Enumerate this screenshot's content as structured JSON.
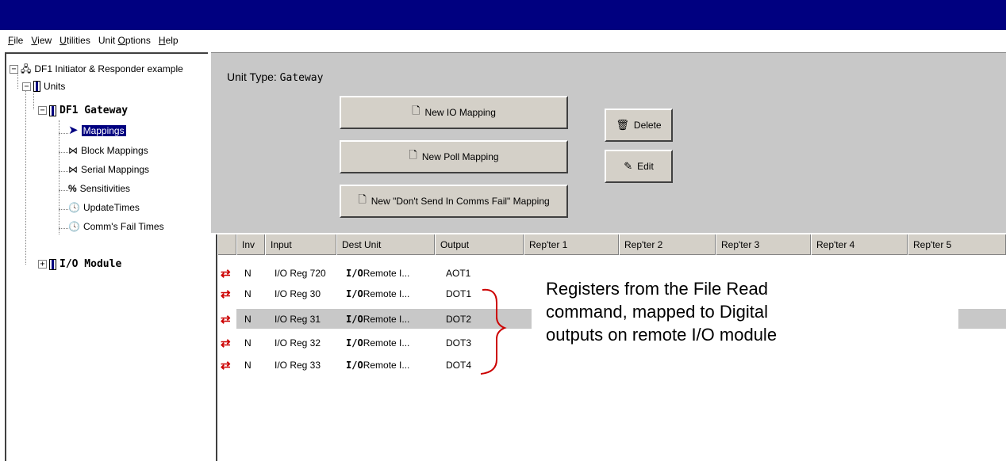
{
  "menu": [
    {
      "label": "File",
      "ul": "F",
      "rest": "ile"
    },
    {
      "label": "View",
      "ul": "V",
      "rest": "iew"
    },
    {
      "label": "Utilities",
      "ul": "U",
      "rest": "tilities"
    },
    {
      "label": "Unit Options",
      "pre": "Unit ",
      "ul": "O",
      "rest": "ptions"
    },
    {
      "label": "Help",
      "ul": "H",
      "rest": "elp"
    }
  ],
  "tree": {
    "root": "DF1 Initiator & Responder example",
    "units": "Units",
    "gateway": "DF1 Gateway",
    "children": [
      "Mappings",
      "Block Mappings",
      "Serial Mappings",
      "Sensitivities",
      "UpdateTimes",
      "Comm's Fail Times"
    ],
    "io_module": "I/O Module"
  },
  "panel": {
    "unit_type_label": "Unit Type:",
    "unit_type_value": "Gateway",
    "buttons": {
      "new_io": "New IO Mapping",
      "new_poll": "New Poll Mapping",
      "new_dont_send": "New \"Don't Send In Comms Fail\" Mapping",
      "delete": "Delete",
      "edit": "Edit"
    }
  },
  "grid": {
    "columns": [
      "Inv",
      "Input",
      "Dest Unit",
      "Output",
      "Rep'ter 1",
      "Rep'ter 2",
      "Rep'ter 3",
      "Rep'ter 4",
      "Rep'ter 5"
    ],
    "rows": [
      {
        "inv": "N",
        "input": "I/O Reg 720",
        "dest_a": "I/O",
        "dest_b": " Remote I...",
        "output": "AOT1"
      },
      {
        "inv": "N",
        "input": "I/O Reg 30",
        "dest_a": "I/O",
        "dest_b": " Remote I...",
        "output": "DOT1"
      },
      {
        "inv": "N",
        "input": "I/O Reg 31",
        "dest_a": "I/O",
        "dest_b": " Remote I...",
        "output": "DOT2"
      },
      {
        "inv": "N",
        "input": "I/O Reg 32",
        "dest_a": "I/O",
        "dest_b": " Remote I...",
        "output": "DOT3"
      },
      {
        "inv": "N",
        "input": "I/O Reg 33",
        "dest_a": "I/O",
        "dest_b": " Remote I...",
        "output": "DOT4"
      }
    ],
    "selected_row": 2
  },
  "annotation": {
    "lines": [
      "Registers from the File Read",
      "command, mapped to Digital",
      "outputs on remote I/O module"
    ]
  },
  "colors": {
    "titlebar": "#000080",
    "arrow": "#cc0000",
    "panel": "#c8c8c8"
  },
  "icons": {
    "root": "network-icon",
    "unit": "unit-icon",
    "mappings": "arrow-icon",
    "block": "bowtie-icon",
    "percent": "percent-icon",
    "clock": "clock-icon",
    "new": "document-icon",
    "delete": "trash-icon",
    "edit": "edit-icon"
  }
}
